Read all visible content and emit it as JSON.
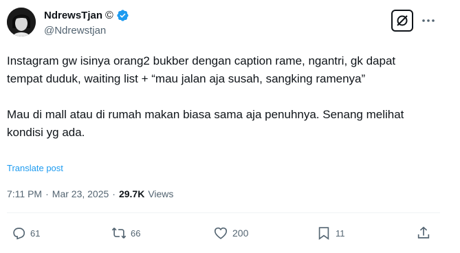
{
  "author": {
    "display_name": "NdrewsTjan",
    "name_suffix_glyph": "©",
    "handle": "@Ndrewstjan",
    "verified": true,
    "verified_color": "#1d9bf0"
  },
  "tweet": {
    "text": "Instagram gw isinya orang2 bukber dengan caption rame, ngantri, gk dapat tempat duduk, waiting list + “mau jalan aja susah, sangking ramenya”\n\nMau di mall atau di rumah makan biasa sama aja penuhnya. Senang melihat kondisi yg ada.",
    "translate_label": "Translate post"
  },
  "meta": {
    "time": "7:11 PM",
    "separator": "·",
    "date": "Mar 23, 2025",
    "views_count": "29.7K",
    "views_label": "Views"
  },
  "actions": {
    "reply_count": "61",
    "repost_count": "66",
    "like_count": "200",
    "bookmark_count": "11"
  },
  "icons": {
    "grok": "grok-icon",
    "more": "more-icon",
    "reply": "reply-icon",
    "repost": "repost-icon",
    "like": "heart-icon",
    "bookmark": "bookmark-icon",
    "share": "share-icon"
  }
}
